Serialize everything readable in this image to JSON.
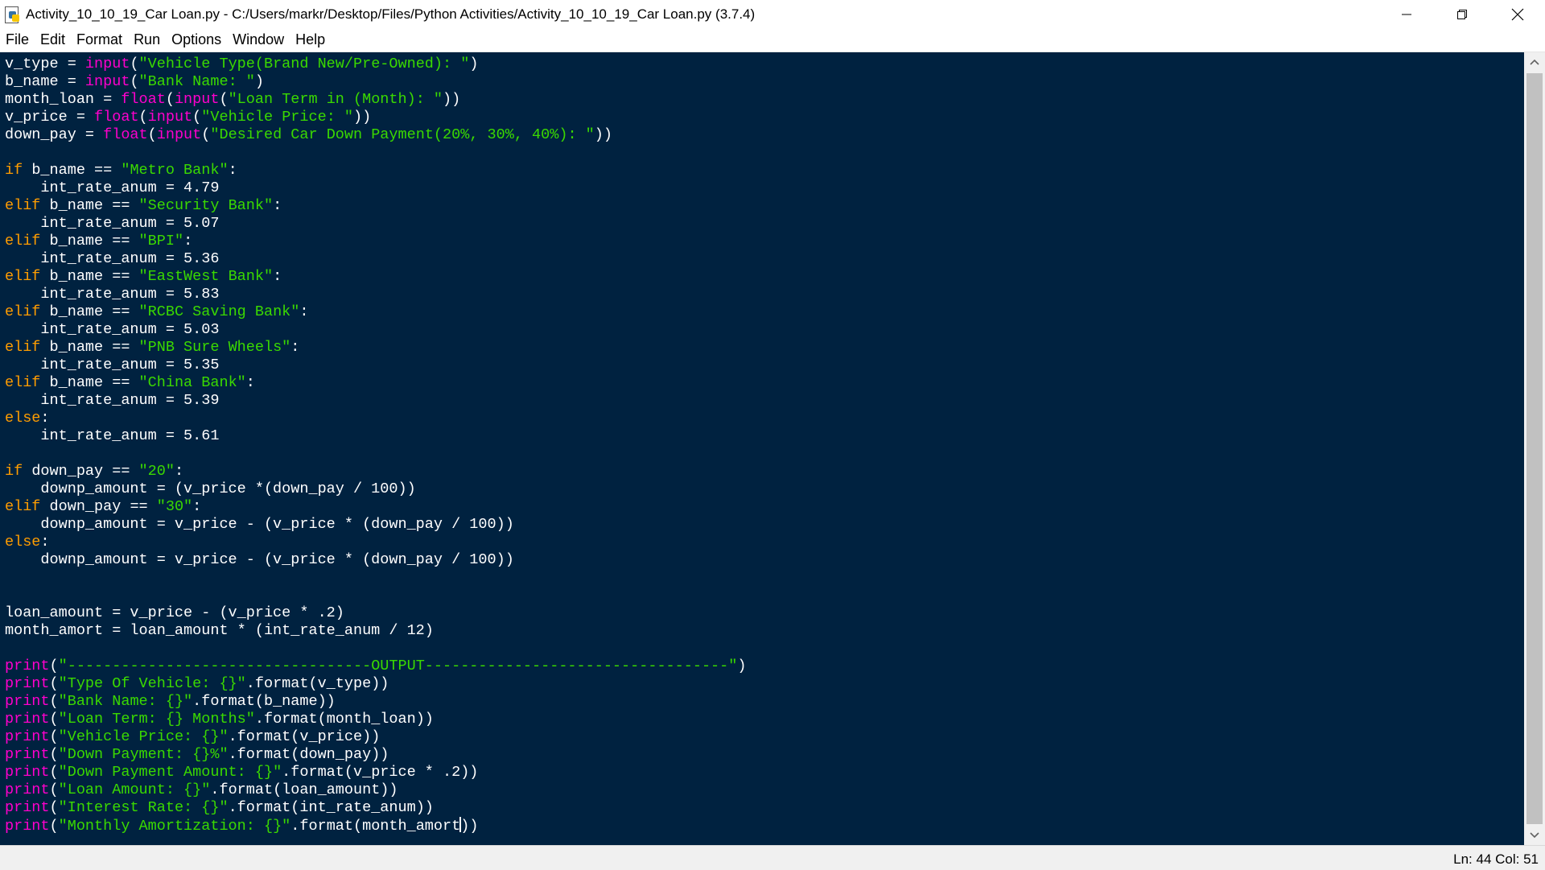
{
  "window": {
    "title": "Activity_10_10_19_Car Loan.py - C:/Users/markr/Desktop/Files/Python Activities/Activity_10_10_19_Car Loan.py (3.7.4)",
    "controls": [
      "minimize-icon",
      "restore-icon",
      "close-icon"
    ]
  },
  "menu": {
    "items": [
      "File",
      "Edit",
      "Format",
      "Run",
      "Options",
      "Window",
      "Help"
    ]
  },
  "editor": {
    "colors": {
      "background": "#002240",
      "text": "#ffffff",
      "keyword": "#ff9d00",
      "builtin": "#ff00cc",
      "string": "#3ad900"
    },
    "lines": [
      [
        [
          "t",
          "v_type = "
        ],
        [
          "b",
          "input"
        ],
        [
          "t",
          "("
        ],
        [
          "s",
          "\"Vehicle Type(Brand New/Pre-Owned): \""
        ],
        [
          "t",
          ")"
        ]
      ],
      [
        [
          "t",
          "b_name = "
        ],
        [
          "b",
          "input"
        ],
        [
          "t",
          "("
        ],
        [
          "s",
          "\"Bank Name: \""
        ],
        [
          "t",
          ")"
        ]
      ],
      [
        [
          "t",
          "month_loan = "
        ],
        [
          "b",
          "float"
        ],
        [
          "t",
          "("
        ],
        [
          "b",
          "input"
        ],
        [
          "t",
          "("
        ],
        [
          "s",
          "\"Loan Term in (Month): \""
        ],
        [
          "t",
          "))"
        ]
      ],
      [
        [
          "t",
          "v_price = "
        ],
        [
          "b",
          "float"
        ],
        [
          "t",
          "("
        ],
        [
          "b",
          "input"
        ],
        [
          "t",
          "("
        ],
        [
          "s",
          "\"Vehicle Price: \""
        ],
        [
          "t",
          "))"
        ]
      ],
      [
        [
          "t",
          "down_pay = "
        ],
        [
          "b",
          "float"
        ],
        [
          "t",
          "("
        ],
        [
          "b",
          "input"
        ],
        [
          "t",
          "("
        ],
        [
          "s",
          "\"Desired Car Down Payment(20%, 30%, 40%): \""
        ],
        [
          "t",
          "))"
        ]
      ],
      [],
      [
        [
          "k",
          "if"
        ],
        [
          "t",
          " b_name == "
        ],
        [
          "s",
          "\"Metro Bank\""
        ],
        [
          "t",
          ":"
        ]
      ],
      [
        [
          "t",
          "    int_rate_anum = 4.79"
        ]
      ],
      [
        [
          "k",
          "elif"
        ],
        [
          "t",
          " b_name == "
        ],
        [
          "s",
          "\"Security Bank\""
        ],
        [
          "t",
          ":"
        ]
      ],
      [
        [
          "t",
          "    int_rate_anum = 5.07"
        ]
      ],
      [
        [
          "k",
          "elif"
        ],
        [
          "t",
          " b_name == "
        ],
        [
          "s",
          "\"BPI\""
        ],
        [
          "t",
          ":"
        ]
      ],
      [
        [
          "t",
          "    int_rate_anum = 5.36"
        ]
      ],
      [
        [
          "k",
          "elif"
        ],
        [
          "t",
          " b_name == "
        ],
        [
          "s",
          "\"EastWest Bank\""
        ],
        [
          "t",
          ":"
        ]
      ],
      [
        [
          "t",
          "    int_rate_anum = 5.83"
        ]
      ],
      [
        [
          "k",
          "elif"
        ],
        [
          "t",
          " b_name == "
        ],
        [
          "s",
          "\"RCBC Saving Bank\""
        ],
        [
          "t",
          ":"
        ]
      ],
      [
        [
          "t",
          "    int_rate_anum = 5.03"
        ]
      ],
      [
        [
          "k",
          "elif"
        ],
        [
          "t",
          " b_name == "
        ],
        [
          "s",
          "\"PNB Sure Wheels\""
        ],
        [
          "t",
          ":"
        ]
      ],
      [
        [
          "t",
          "    int_rate_anum = 5.35"
        ]
      ],
      [
        [
          "k",
          "elif"
        ],
        [
          "t",
          " b_name == "
        ],
        [
          "s",
          "\"China Bank\""
        ],
        [
          "t",
          ":"
        ]
      ],
      [
        [
          "t",
          "    int_rate_anum = 5.39"
        ]
      ],
      [
        [
          "k",
          "else"
        ],
        [
          "t",
          ":"
        ]
      ],
      [
        [
          "t",
          "    int_rate_anum = 5.61"
        ]
      ],
      [],
      [
        [
          "k",
          "if"
        ],
        [
          "t",
          " down_pay == "
        ],
        [
          "s",
          "\"20\""
        ],
        [
          "t",
          ":"
        ]
      ],
      [
        [
          "t",
          "    downp_amount = (v_price *(down_pay / 100))"
        ]
      ],
      [
        [
          "k",
          "elif"
        ],
        [
          "t",
          " down_pay == "
        ],
        [
          "s",
          "\"30\""
        ],
        [
          "t",
          ":"
        ]
      ],
      [
        [
          "t",
          "    downp_amount = v_price - (v_price * (down_pay / 100))"
        ]
      ],
      [
        [
          "k",
          "else"
        ],
        [
          "t",
          ":"
        ]
      ],
      [
        [
          "t",
          "    downp_amount = v_price - (v_price * (down_pay / 100))"
        ]
      ],
      [],
      [],
      [
        [
          "t",
          "loan_amount = v_price - (v_price * .2)"
        ]
      ],
      [
        [
          "t",
          "month_amort = loan_amount * (int_rate_anum / 12)"
        ]
      ],
      [],
      [
        [
          "b",
          "print"
        ],
        [
          "t",
          "("
        ],
        [
          "s",
          "\"----------------------------------OUTPUT----------------------------------\""
        ],
        [
          "t",
          ")"
        ]
      ],
      [
        [
          "b",
          "print"
        ],
        [
          "t",
          "("
        ],
        [
          "s",
          "\"Type Of Vehicle: {}\""
        ],
        [
          "t",
          ".format(v_type))"
        ]
      ],
      [
        [
          "b",
          "print"
        ],
        [
          "t",
          "("
        ],
        [
          "s",
          "\"Bank Name: {}\""
        ],
        [
          "t",
          ".format(b_name))"
        ]
      ],
      [
        [
          "b",
          "print"
        ],
        [
          "t",
          "("
        ],
        [
          "s",
          "\"Loan Term: {} Months\""
        ],
        [
          "t",
          ".format(month_loan))"
        ]
      ],
      [
        [
          "b",
          "print"
        ],
        [
          "t",
          "("
        ],
        [
          "s",
          "\"Vehicle Price: {}\""
        ],
        [
          "t",
          ".format(v_price))"
        ]
      ],
      [
        [
          "b",
          "print"
        ],
        [
          "t",
          "("
        ],
        [
          "s",
          "\"Down Payment: {}%\""
        ],
        [
          "t",
          ".format(down_pay))"
        ]
      ],
      [
        [
          "b",
          "print"
        ],
        [
          "t",
          "("
        ],
        [
          "s",
          "\"Down Payment Amount: {}\""
        ],
        [
          "t",
          ".format(v_price * .2))"
        ]
      ],
      [
        [
          "b",
          "print"
        ],
        [
          "t",
          "("
        ],
        [
          "s",
          "\"Loan Amount: {}\""
        ],
        [
          "t",
          ".format(loan_amount))"
        ]
      ],
      [
        [
          "b",
          "print"
        ],
        [
          "t",
          "("
        ],
        [
          "s",
          "\"Interest Rate: {}\""
        ],
        [
          "t",
          ".format(int_rate_anum))"
        ]
      ],
      [
        [
          "b",
          "print"
        ],
        [
          "t",
          "("
        ],
        [
          "s",
          "\"Monthly Amortization: {}\""
        ],
        [
          "t",
          ".format(month_amort"
        ],
        [
          "c",
          ""
        ],
        [
          "t",
          "))"
        ]
      ]
    ]
  },
  "scrollbar": {
    "up_icon": "chevron-up-icon",
    "down_icon": "chevron-down-icon"
  },
  "status": {
    "position": "Ln: 44  Col: 51"
  }
}
